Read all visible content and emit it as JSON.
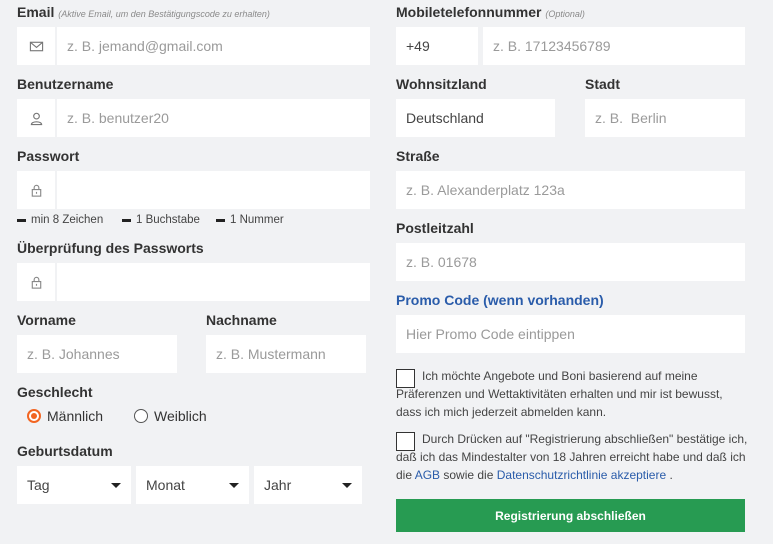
{
  "email": {
    "label": "Email",
    "hint": "(Aktive Email, um den Bestätigungscode zu erhalten)",
    "placeholder": "z. B. jemand@gmail.com",
    "icon": "envelope-icon"
  },
  "username": {
    "label": "Benutzername",
    "placeholder": "z. B. benutzer20",
    "icon": "user-icon"
  },
  "password": {
    "label": "Passwort",
    "icon": "lock-icon",
    "requirements": [
      "min 8 Zeichen",
      "1 Buchstabe",
      "1 Nummer"
    ]
  },
  "password_confirm": {
    "label": "Überprüfung des Passworts",
    "icon": "lock-icon"
  },
  "first_name": {
    "label": "Vorname",
    "placeholder": "z. B. Johannes"
  },
  "last_name": {
    "label": "Nachname",
    "placeholder": "z. B. Mustermann"
  },
  "gender": {
    "label": "Geschlecht",
    "options": [
      "Männlich",
      "Weiblich"
    ],
    "selected": "Männlich",
    "accent_color": "#f26522"
  },
  "birthdate": {
    "label": "Geburtsdatum",
    "day": "Tag",
    "month": "Monat",
    "year": "Jahr"
  },
  "mobile": {
    "label": "Mobiletelefonnummer",
    "hint": "(Optional)",
    "prefix": "+49",
    "placeholder": "z. B. 17123456789"
  },
  "country": {
    "label": "Wohnsitzland",
    "value": "Deutschland"
  },
  "city": {
    "label": "Stadt",
    "placeholder": "z. B.  Berlin"
  },
  "street": {
    "label": "Straße",
    "placeholder": "z. B. Alexanderplatz 123a"
  },
  "postcode": {
    "label": "Postleitzahl",
    "placeholder": "z. B. 01678"
  },
  "promo": {
    "label": "Promo Code (wenn vorhanden)",
    "placeholder": "Hier Promo Code eintippen",
    "color": "#2a5caa"
  },
  "consent_offers": {
    "text": "Ich möchte Angebote und Boni basierend auf meine Präferenzen und Wettaktivitäten erhalten und mir ist bewusst, dass ich mich jederzeit abmelden kann."
  },
  "consent_terms": {
    "text_before": "Durch Drücken auf \"Registrierung abschließen\" bestätige ich, daß ich das Mindestalter von 18 Jahren erreicht habe und daß ich die ",
    "link_agb": "AGB",
    "text_middle": " sowie die ",
    "link_privacy": "Datenschutzrichtlinie akzeptiere",
    "text_end": " ."
  },
  "submit": {
    "label": "Registrierung abschließen",
    "color": "#279b52"
  }
}
